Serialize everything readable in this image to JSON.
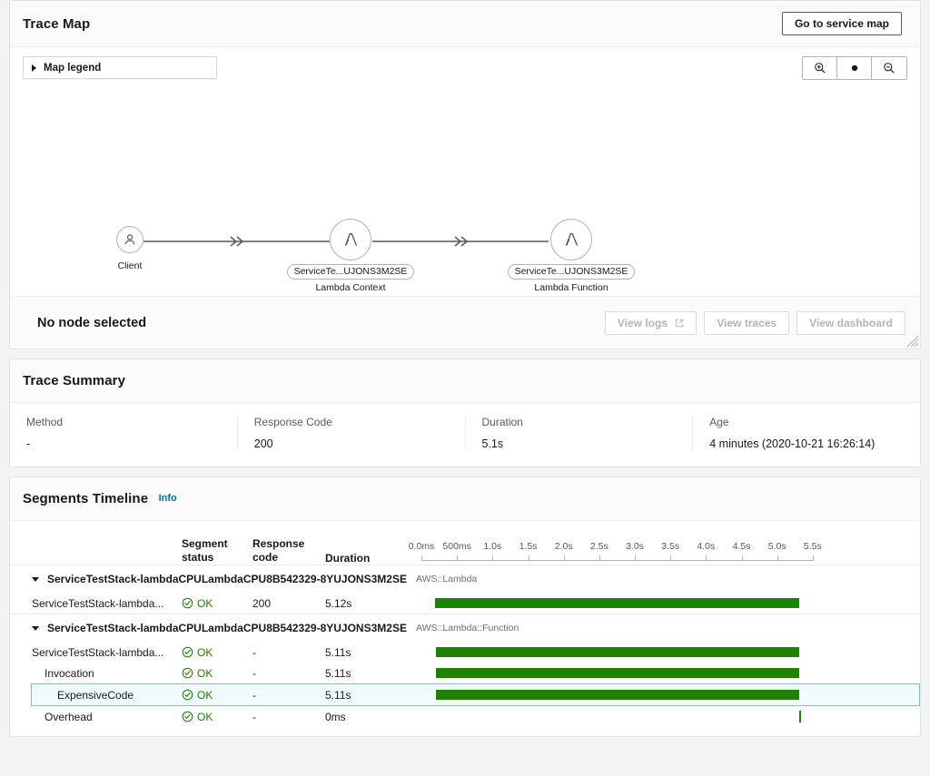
{
  "trace_map": {
    "title": "Trace Map",
    "service_map_button": "Go to service map",
    "map_legend_label": "Map legend",
    "zoom_in_icon": "zoom-in-icon",
    "zoom_reset_icon": "dot-icon",
    "zoom_out_icon": "zoom-out-icon",
    "nodes": [
      {
        "id": "client",
        "icon": "person-icon",
        "caption": "Client",
        "pill": null
      },
      {
        "id": "lambda-context",
        "icon": "lambda-icon",
        "caption": "Lambda Context",
        "pill": "ServiceTe...UJONS3M2SE"
      },
      {
        "id": "lambda-function",
        "icon": "lambda-icon",
        "caption": "Lambda Function",
        "pill": "ServiceTe...UJONS3M2SE"
      }
    ],
    "selection": {
      "status": "No node selected",
      "buttons": [
        {
          "label": "View logs",
          "icon": "external-link-icon",
          "disabled": true
        },
        {
          "label": "View traces",
          "icon": null,
          "disabled": true
        },
        {
          "label": "View dashboard",
          "icon": null,
          "disabled": true
        }
      ]
    }
  },
  "trace_summary": {
    "title": "Trace Summary",
    "fields": [
      {
        "label": "Method",
        "value": "-"
      },
      {
        "label": "Response Code",
        "value": "200"
      },
      {
        "label": "Duration",
        "value": "5.1s"
      },
      {
        "label": "Age",
        "value": "4 minutes (2020-10-21 16:26:14)"
      }
    ]
  },
  "segments_timeline": {
    "title": "Segments Timeline",
    "info_label": "Info",
    "columns": {
      "name": "",
      "status_line1": "Segment",
      "status_line2": "status",
      "code_line1": "Response",
      "code_line2": "code",
      "duration": "Duration"
    },
    "axis": {
      "ticks": [
        "0.0ms",
        "500ms",
        "1.0s",
        "1.5s",
        "2.0s",
        "2.5s",
        "3.0s",
        "3.5s",
        "4.0s",
        "4.5s",
        "5.0s",
        "5.5s"
      ],
      "min_s": 0,
      "max_s": 5.5
    },
    "groups": [
      {
        "name": "ServiceTestStack-lambdaCPULambdaCPU8B542329-8YUJONS3M2SE",
        "type": "AWS::Lambda",
        "expanded": true,
        "rows": [
          {
            "name": "ServiceTestStack-lambda...",
            "status": "OK",
            "code": "200",
            "duration": "5.12s",
            "indent": 0,
            "selected": false,
            "bar_start_s": 0.19,
            "bar_end_s": 5.31
          }
        ]
      },
      {
        "name": "ServiceTestStack-lambdaCPULambdaCPU8B542329-8YUJONS3M2SE",
        "type": "AWS::Lambda::Function",
        "expanded": true,
        "rows": [
          {
            "name": "ServiceTestStack-lambda...",
            "status": "OK",
            "code": "-",
            "duration": "5.11s",
            "indent": 0,
            "selected": false,
            "bar_start_s": 0.2,
            "bar_end_s": 5.31
          },
          {
            "name": "Invocation",
            "status": "OK",
            "code": "-",
            "duration": "5.11s",
            "indent": 1,
            "selected": false,
            "bar_start_s": 0.2,
            "bar_end_s": 5.31
          },
          {
            "name": "ExpensiveCode",
            "status": "OK",
            "code": "-",
            "duration": "5.11s",
            "indent": 2,
            "selected": true,
            "bar_start_s": 0.2,
            "bar_end_s": 5.31
          },
          {
            "name": "Overhead",
            "status": "OK",
            "code": "-",
            "duration": "0ms",
            "indent": 1,
            "selected": false,
            "bar_start_s": 5.31,
            "bar_end_s": 5.31
          }
        ]
      }
    ]
  },
  "colors": {
    "bar_green": "#1d8102",
    "status_green": "#1d8102",
    "link_blue": "#0073bb",
    "selected_row_bg": "#f1faff",
    "selected_row_border": "#7fbcd8"
  }
}
